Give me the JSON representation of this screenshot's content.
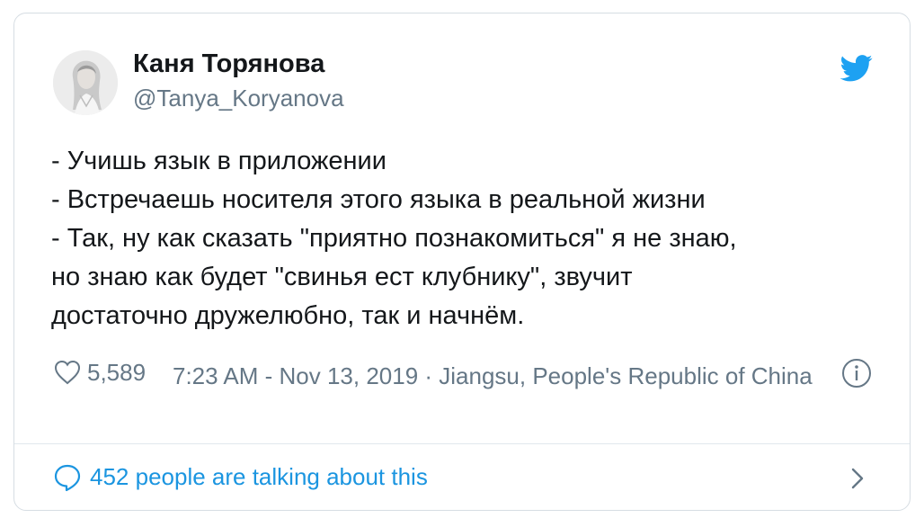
{
  "author": {
    "display_name": "Каня Торянова",
    "handle": "@Tanya_Koryanova"
  },
  "icons": {
    "brand": "twitter-bird-icon",
    "like": "heart-icon",
    "info": "info-icon",
    "reply": "speech-bubble-icon",
    "open": "chevron-right-icon"
  },
  "tweet": {
    "lines": [
      "- Учишь язык в приложении",
      "- Встречаешь носителя этого языка в реальной жизни",
      "- Так, ну как сказать \"приятно познакомиться\" я не знаю,",
      "но знаю как будет \"свинья ест клубнику\", звучит",
      "достаточно дружелюбно, так и начнём."
    ]
  },
  "meta": {
    "likes": "5,589",
    "timestamp_location": "7:23 AM - Nov 13, 2019 · Jiangsu, People's Republic of China"
  },
  "footer": {
    "talking": "452 people are talking about this"
  },
  "colors": {
    "accent": "#1da1f2",
    "link": "#1b95e0",
    "text": "#14171a",
    "muted": "#657786",
    "border": "#d6dde3"
  }
}
